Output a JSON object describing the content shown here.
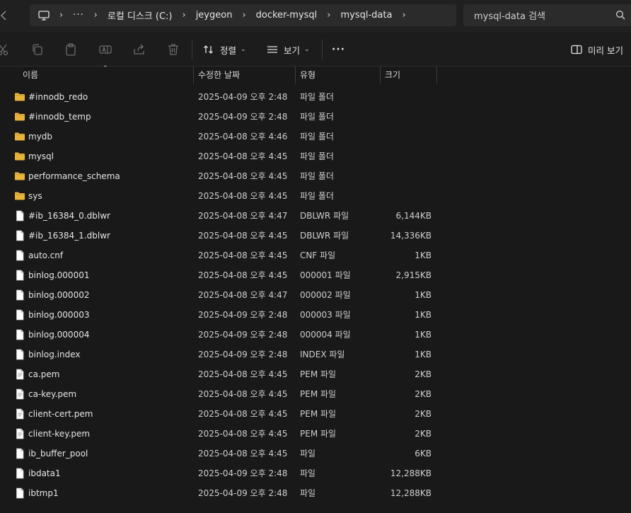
{
  "address": {
    "more": "···",
    "breadcrumbs": [
      "로컬 디스크 (C:)",
      "jeygeon",
      "docker-mysql",
      "mysql-data"
    ]
  },
  "search": {
    "placeholder": "mysql-data 검색"
  },
  "commands": {
    "sort_label": "정렬",
    "view_label": "보기",
    "more_label": "···",
    "preview_label": "미리 보기"
  },
  "columns": {
    "name": "이름",
    "date": "수정한 날짜",
    "type": "유형",
    "size": "크기"
  },
  "files": [
    {
      "name": "#innodb_redo",
      "date": "2025-04-09 오후 2:48",
      "type": "파일 폴더",
      "size": "",
      "kind": "folder-icon"
    },
    {
      "name": "#innodb_temp",
      "date": "2025-04-09 오후 2:48",
      "type": "파일 폴더",
      "size": "",
      "kind": "folder-icon"
    },
    {
      "name": "mydb",
      "date": "2025-04-08 오후 4:46",
      "type": "파일 폴더",
      "size": "",
      "kind": "folder-icon"
    },
    {
      "name": "mysql",
      "date": "2025-04-08 오후 4:45",
      "type": "파일 폴더",
      "size": "",
      "kind": "folder-icon"
    },
    {
      "name": "performance_schema",
      "date": "2025-04-08 오후 4:45",
      "type": "파일 폴더",
      "size": "",
      "kind": "folder-icon"
    },
    {
      "name": "sys",
      "date": "2025-04-08 오후 4:45",
      "type": "파일 폴더",
      "size": "",
      "kind": "folder-icon"
    },
    {
      "name": "#ib_16384_0.dblwr",
      "date": "2025-04-08 오후 4:47",
      "type": "DBLWR 파일",
      "size": "6,144KB",
      "kind": "file-icon"
    },
    {
      "name": "#ib_16384_1.dblwr",
      "date": "2025-04-08 오후 4:45",
      "type": "DBLWR 파일",
      "size": "14,336KB",
      "kind": "file-icon"
    },
    {
      "name": "auto.cnf",
      "date": "2025-04-08 오후 4:45",
      "type": "CNF 파일",
      "size": "1KB",
      "kind": "file-icon"
    },
    {
      "name": "binlog.000001",
      "date": "2025-04-08 오후 4:45",
      "type": "000001 파일",
      "size": "2,915KB",
      "kind": "file-icon"
    },
    {
      "name": "binlog.000002",
      "date": "2025-04-08 오후 4:47",
      "type": "000002 파일",
      "size": "1KB",
      "kind": "file-icon"
    },
    {
      "name": "binlog.000003",
      "date": "2025-04-09 오후 2:48",
      "type": "000003 파일",
      "size": "1KB",
      "kind": "file-icon"
    },
    {
      "name": "binlog.000004",
      "date": "2025-04-09 오후 2:48",
      "type": "000004 파일",
      "size": "1KB",
      "kind": "file-icon"
    },
    {
      "name": "binlog.index",
      "date": "2025-04-09 오후 2:48",
      "type": "INDEX 파일",
      "size": "1KB",
      "kind": "file-icon"
    },
    {
      "name": "ca.pem",
      "date": "2025-04-08 오후 4:45",
      "type": "PEM 파일",
      "size": "2KB",
      "kind": "cert-file-icon"
    },
    {
      "name": "ca-key.pem",
      "date": "2025-04-08 오후 4:45",
      "type": "PEM 파일",
      "size": "2KB",
      "kind": "cert-file-icon"
    },
    {
      "name": "client-cert.pem",
      "date": "2025-04-08 오후 4:45",
      "type": "PEM 파일",
      "size": "2KB",
      "kind": "cert-file-icon"
    },
    {
      "name": "client-key.pem",
      "date": "2025-04-08 오후 4:45",
      "type": "PEM 파일",
      "size": "2KB",
      "kind": "cert-file-icon"
    },
    {
      "name": "ib_buffer_pool",
      "date": "2025-04-08 오후 4:45",
      "type": "파일",
      "size": "6KB",
      "kind": "file-icon"
    },
    {
      "name": "ibdata1",
      "date": "2025-04-09 오후 2:48",
      "type": "파일",
      "size": "12,288KB",
      "kind": "file-icon"
    },
    {
      "name": "ibtmp1",
      "date": "2025-04-09 오후 2:48",
      "type": "파일",
      "size": "12,288KB",
      "kind": "file-icon"
    }
  ],
  "colors": {
    "folder": "#e8b33a",
    "background": "#191919",
    "accent": "#4cc2ff"
  }
}
